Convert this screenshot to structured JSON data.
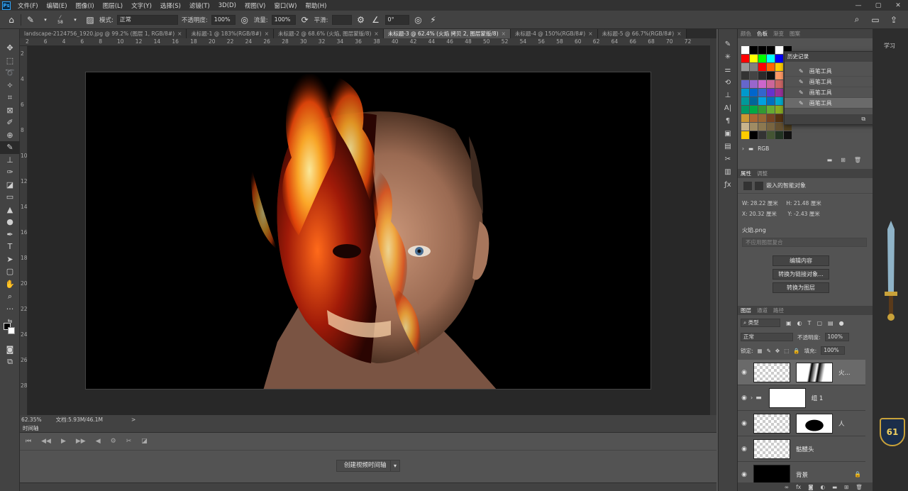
{
  "menu": {
    "items": [
      "文件(F)",
      "编辑(E)",
      "图像(I)",
      "图层(L)",
      "文字(Y)",
      "选择(S)",
      "滤镜(T)",
      "3D(D)",
      "视图(V)",
      "窗口(W)",
      "帮助(H)"
    ],
    "win": [
      "—",
      "▢",
      "✕"
    ]
  },
  "options": {
    "brush_size": "58",
    "mode_label": "模式:",
    "mode_value": "正常",
    "opacity_label": "不透明度:",
    "opacity_value": "100%",
    "flow_label": "流量:",
    "flow_value": "100%",
    "smooth_label": "平滑:",
    "smooth_value": "",
    "angle_value": "0°"
  },
  "tabs": [
    {
      "label": "landscape-2124756_1920.jpg @ 99.2% (图层 1, RGB/8#)",
      "active": false
    },
    {
      "label": "未标题-1 @ 183%(RGB/8#)",
      "active": false
    },
    {
      "label": "未标题-2 @ 68.6% (火焰, 图层蒙版/8)",
      "active": false
    },
    {
      "label": "未标题-3 @ 62.4% (火焰 拷贝 2, 图层蒙版/8)",
      "active": true
    },
    {
      "label": "未标题-4 @ 150%(RGB/8#)",
      "active": false
    },
    {
      "label": "未标题-5 @ 66.7%(RGB/8#)",
      "active": false
    }
  ],
  "ruler_top": [
    "2",
    "6",
    "4",
    "6",
    "8",
    "10",
    "12",
    "14",
    "16",
    "18",
    "20",
    "22",
    "24",
    "26",
    "28",
    "30",
    "32",
    "34",
    "36",
    "38",
    "40",
    "42",
    "44",
    "46",
    "48",
    "50",
    "52",
    "54",
    "56",
    "58",
    "60",
    "62",
    "64",
    "66",
    "68",
    "70",
    "72"
  ],
  "ruler_left": [
    "2",
    "4",
    "6",
    "8",
    "10",
    "12",
    "14",
    "16",
    "18",
    "20",
    "22",
    "24",
    "26",
    "28"
  ],
  "status": {
    "zoom": "62.35%",
    "doc": "文档:5.93M/46.1M",
    "arrow": ">"
  },
  "timeline": {
    "title": "时间轴",
    "create_label": "创建视频时间轴"
  },
  "color_panel": {
    "tabs": [
      "颜色",
      "色板",
      "渐变",
      "图案"
    ],
    "active": "色板",
    "group_label": "RGB"
  },
  "swatch_rows": [
    [
      "#ffffff",
      "#000000",
      "#000000",
      "#000000",
      "#ffffff",
      "#000000"
    ],
    [
      "#ff0000",
      "#ffff00",
      "#00ff00",
      "#00ffff",
      "#0000ff",
      "#ff00ff"
    ],
    [
      "#999999",
      "#808080",
      "#ff0000",
      "#ff6600",
      "#ffcc00",
      "#33cc33"
    ],
    [
      "#333333",
      "#444444",
      "#2b2b2b",
      "#111111",
      "#ff9966",
      "#ffcc99"
    ],
    [
      "#6666cc",
      "#9966cc",
      "#cc66cc",
      "#cc6699",
      "#cc6666",
      "#cc9966"
    ],
    [
      "#0099cc",
      "#0066cc",
      "#3366cc",
      "#6633cc",
      "#993399",
      "#cc3366"
    ],
    [
      "#009999",
      "#006699",
      "#00a0e0",
      "#0070c0",
      "#00aacc",
      "#3399ff"
    ],
    [
      "#009966",
      "#00aa44",
      "#339933",
      "#66aa33",
      "#88aa22",
      "#aa8822"
    ],
    [
      "#cc9933",
      "#aa6633",
      "#996633",
      "#774422",
      "#553311",
      "#442211"
    ],
    [
      "#c8b48c",
      "#a08c64",
      "#8c7850",
      "#786440",
      "#645030",
      "#504020"
    ],
    [
      "#ffcc00",
      "#000000",
      "#333333",
      "#445533",
      "#223322",
      "#111111"
    ]
  ],
  "history": {
    "title": "历史记录",
    "items": [
      "画笔工具",
      "画笔工具",
      "画笔工具",
      "画笔工具"
    ]
  },
  "properties": {
    "tabs": [
      "属性",
      "调整"
    ],
    "kind": "嵌入的智能对象",
    "w_label": "W:",
    "w_value": "28.22 厘米",
    "h_label": "H:",
    "h_value": "21.48 厘米",
    "x_label": "X:",
    "x_value": "20.32 厘米",
    "y_label": "Y:",
    "y_value": "-2.43 厘米",
    "file": "火焰.png",
    "comp": "不应用图层复合",
    "btn_edit": "编辑内容",
    "btn_link": "转换为链接对象...",
    "btn_layer": "转换为图层"
  },
  "layers_panel": {
    "tabs": [
      "图层",
      "通道",
      "路径"
    ],
    "filter": "类型",
    "blend": "正常",
    "opacity_label": "不透明度:",
    "opacity_value": "100%",
    "lock_label": "锁定:",
    "fill_label": "填充:",
    "fill_value": "100%"
  },
  "layers": [
    {
      "name": "火...",
      "selected": true
    },
    {
      "name": "组 1",
      "selected": false
    },
    {
      "name": "人",
      "selected": false
    },
    {
      "name": "骷髅头",
      "selected": false
    },
    {
      "name": "背景",
      "selected": false
    }
  ],
  "side": {
    "learn": "学习",
    "badge": "61"
  }
}
